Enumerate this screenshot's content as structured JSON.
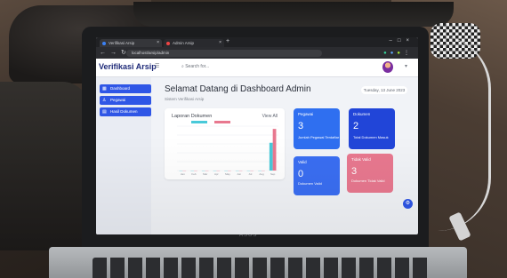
{
  "browser": {
    "tabs": [
      {
        "label": "Verifikasi Arsip"
      },
      {
        "label": "Admin Arsip"
      }
    ],
    "url": "localhost/arsip/admin"
  },
  "app": {
    "brand": "Verifikasi Arsip",
    "search_placeholder": "Search for...",
    "accent": "#2f56e6"
  },
  "sidebar": {
    "items": [
      {
        "label": "Dashboard",
        "icon": "grid-icon"
      },
      {
        "label": "Pegawai",
        "icon": "user-icon"
      },
      {
        "label": "Hasil Dokumen",
        "icon": "document-icon"
      }
    ]
  },
  "main": {
    "title": "Selamat Datang di Dashboard Admin",
    "subtitle": "Sistem Verifikasi Arsip",
    "date": "Tuesday, 13 June 2023",
    "chart_card": {
      "title": "Laporan Dokumen",
      "link": "View All"
    },
    "stats": [
      {
        "label": "Pegawai",
        "value": "3",
        "desc": "Jumlah Pegawai Terdaftar",
        "color": "#2f6ff0"
      },
      {
        "label": "Dokumen",
        "value": "2",
        "desc": "Total Dokumen Masuk",
        "color": "#2145d8"
      },
      {
        "label": "Valid",
        "value": "0",
        "desc": "Dokumen Valid",
        "color": "#3a6ef2"
      },
      {
        "label": "Tidak Valid",
        "value": "3",
        "desc": "Dokumen Tidak Valid",
        "color": "#e8788f"
      }
    ]
  },
  "chart_data": {
    "type": "bar",
    "title": "Laporan Dokumen",
    "categories": [
      "Jan",
      "Feb",
      "Mar",
      "Apr",
      "May",
      "Jun",
      "Jul",
      "Aug",
      "Sep"
    ],
    "series": [
      {
        "values": [
          0,
          0,
          0,
          0,
          0,
          0,
          0,
          0,
          2
        ],
        "color": "#48c9d9"
      },
      {
        "values": [
          0,
          0,
          0,
          0,
          0,
          0,
          0,
          0,
          3
        ],
        "color": "#e8788f"
      }
    ],
    "ylim": [
      0,
      3.2
    ],
    "grid": true,
    "legend": "top"
  }
}
